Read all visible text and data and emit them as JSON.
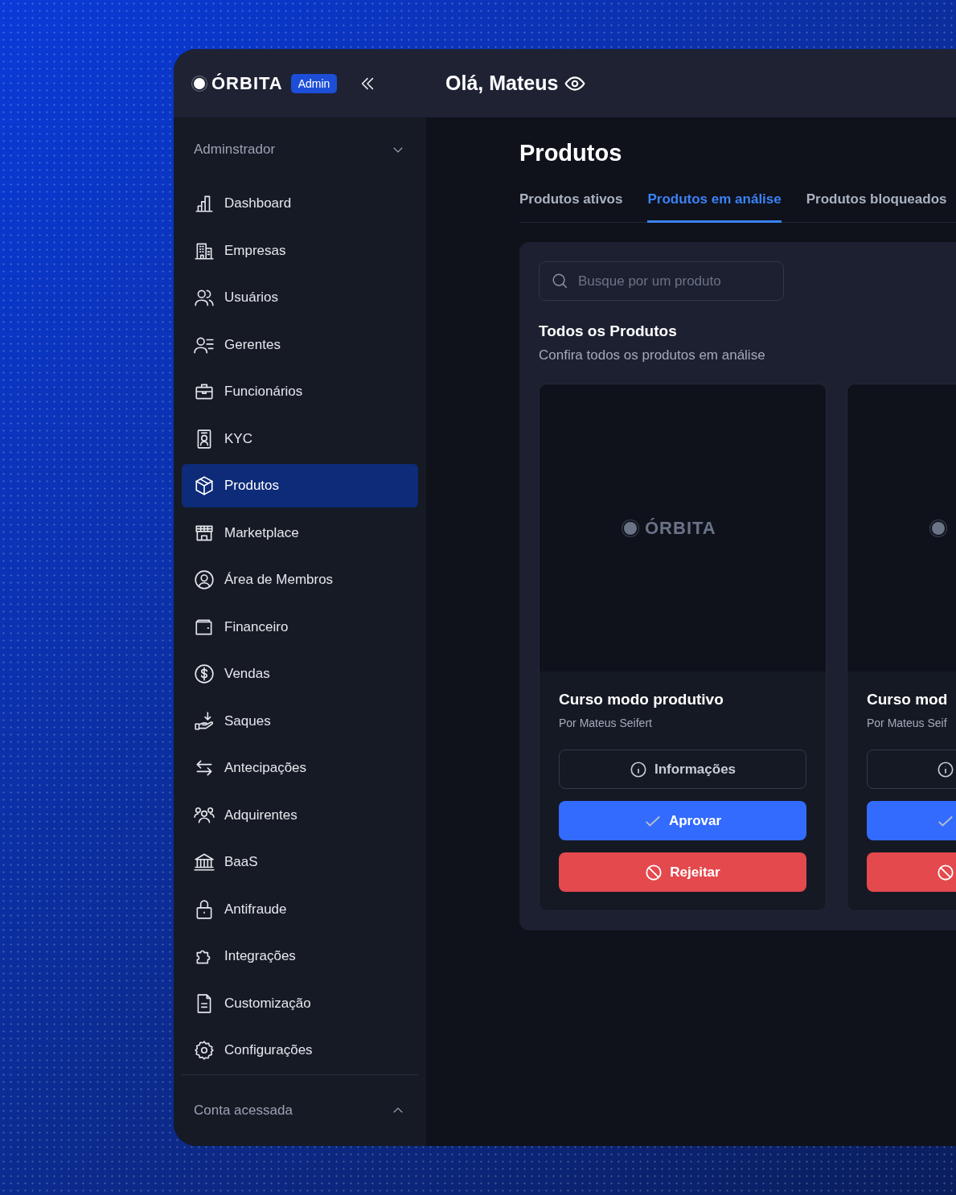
{
  "header": {
    "logo": "ÓRBITA",
    "badge": "Admin",
    "greeting": "Olá, Mateus"
  },
  "sidebar": {
    "section": {
      "label": "Adminstrador",
      "expanded": true
    },
    "items": [
      {
        "label": "Dashboard",
        "selected": false
      },
      {
        "label": "Empresas",
        "selected": false
      },
      {
        "label": "Usuários",
        "selected": false
      },
      {
        "label": "Gerentes",
        "selected": false
      },
      {
        "label": "Funcionários",
        "selected": false
      },
      {
        "label": "KYC",
        "selected": false
      },
      {
        "label": "Produtos",
        "selected": true
      },
      {
        "label": "Marketplace",
        "selected": false
      },
      {
        "label": "Área de Membros",
        "selected": false
      },
      {
        "label": "Financeiro",
        "selected": false
      },
      {
        "label": "Vendas",
        "selected": false
      },
      {
        "label": "Saques",
        "selected": false
      },
      {
        "label": "Antecipações",
        "selected": false
      },
      {
        "label": "Adquirentes",
        "selected": false
      },
      {
        "label": "BaaS",
        "selected": false
      },
      {
        "label": "Antifraude",
        "selected": false
      },
      {
        "label": "Integrações",
        "selected": false
      },
      {
        "label": "Customização",
        "selected": false
      },
      {
        "label": "Configurações",
        "selected": false
      }
    ],
    "footer": {
      "label": "Conta acessada",
      "expanded": false
    }
  },
  "page": {
    "title": "Produtos",
    "tabs": [
      {
        "label": "Produtos ativos",
        "selected": false
      },
      {
        "label": "Produtos em análise",
        "selected": true
      },
      {
        "label": "Produtos bloqueados",
        "selected": false
      }
    ],
    "search": {
      "placeholder": "Busque por um produto"
    },
    "list_title": "Todos os Produtos",
    "list_subtitle": "Confira todos os produtos em análise",
    "products": [
      {
        "logo": "ÓRBITA",
        "title": "Curso modo produtivo",
        "author": "Por Mateus Seifert",
        "actions": [
          {
            "kind": "info",
            "label": "Informações"
          },
          {
            "kind": "approve",
            "label": "Aprovar"
          },
          {
            "kind": "reject",
            "label": "Rejeitar"
          }
        ]
      },
      {
        "title": "Curso mod",
        "author": "Por Mateus Seif",
        "actions": [
          {
            "kind": "info"
          },
          {
            "kind": "approve"
          },
          {
            "kind": "reject"
          }
        ]
      }
    ]
  }
}
